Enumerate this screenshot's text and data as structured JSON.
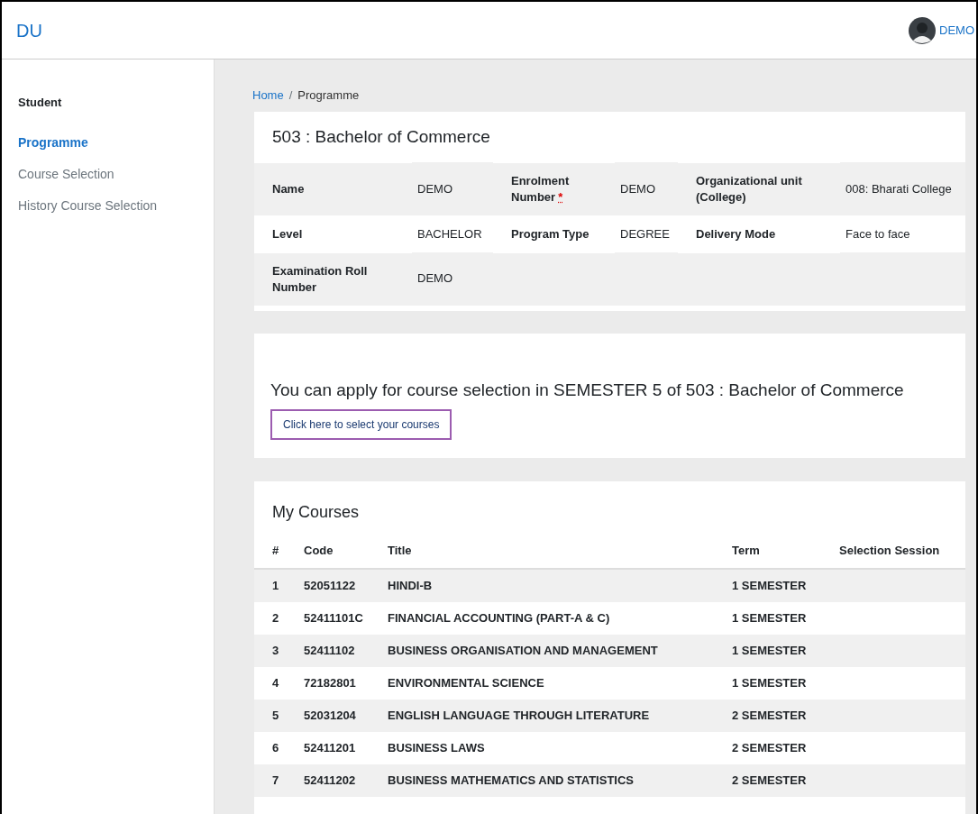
{
  "header": {
    "brand": "DU",
    "user": "DEMO"
  },
  "sidebar": {
    "heading": "Student",
    "items": [
      {
        "label": "Programme",
        "selected": true
      },
      {
        "label": "Course Selection",
        "selected": false
      },
      {
        "label": "History Course Selection",
        "selected": false
      }
    ]
  },
  "breadcrumb": [
    {
      "label": "Home",
      "link": true
    },
    {
      "separator": "/",
      "label": "Programme",
      "link": false
    }
  ],
  "programme": {
    "title": "503 : Bachelor of Commerce",
    "rows": [
      [
        {
          "label": "Name",
          "value": "DEMO"
        },
        {
          "label": "Enrolment Number",
          "required": true,
          "value": "DEMO"
        },
        {
          "label": "Organizational unit (College)",
          "value": "008: Bharati College"
        }
      ],
      [
        {
          "label": "Level",
          "value": "BACHELOR"
        },
        {
          "label": "Program Type",
          "value": "DEGREE"
        },
        {
          "label": "Delivery Mode",
          "value": "Face to face"
        }
      ],
      [
        {
          "label": "Examination Roll Number",
          "value": "DEMO"
        }
      ]
    ],
    "required_mark": "*"
  },
  "notice": {
    "message": "You can apply for course selection in SEMESTER 5 of 503 : Bachelor of Commerce",
    "link": "Click here to select your courses"
  },
  "courses": {
    "title": "My Courses",
    "columns": [
      "#",
      "Code",
      "Title",
      "Term",
      "Selection Session"
    ],
    "rows": [
      [
        "1",
        "52051122",
        "HINDI-B",
        "1 SEMESTER"
      ],
      [
        "2",
        "52411101C",
        "FINANCIAL ACCOUNTING (PART-A & C)",
        "1 SEMESTER"
      ],
      [
        "3",
        "52411102",
        "BUSINESS ORGANISATION AND MANAGEMENT",
        "1 SEMESTER"
      ],
      [
        "4",
        "72182801",
        "ENVIRONMENTAL SCIENCE",
        "1 SEMESTER"
      ],
      [
        "5",
        "52031204",
        "ENGLISH LANGUAGE THROUGH LITERATURE",
        "2 SEMESTER"
      ],
      [
        "6",
        "52411201",
        "BUSINESS LAWS",
        "2 SEMESTER"
      ],
      [
        "7",
        "52411202",
        "BUSINESS MATHEMATICS AND STATISTICS",
        "2 SEMESTER"
      ]
    ]
  }
}
